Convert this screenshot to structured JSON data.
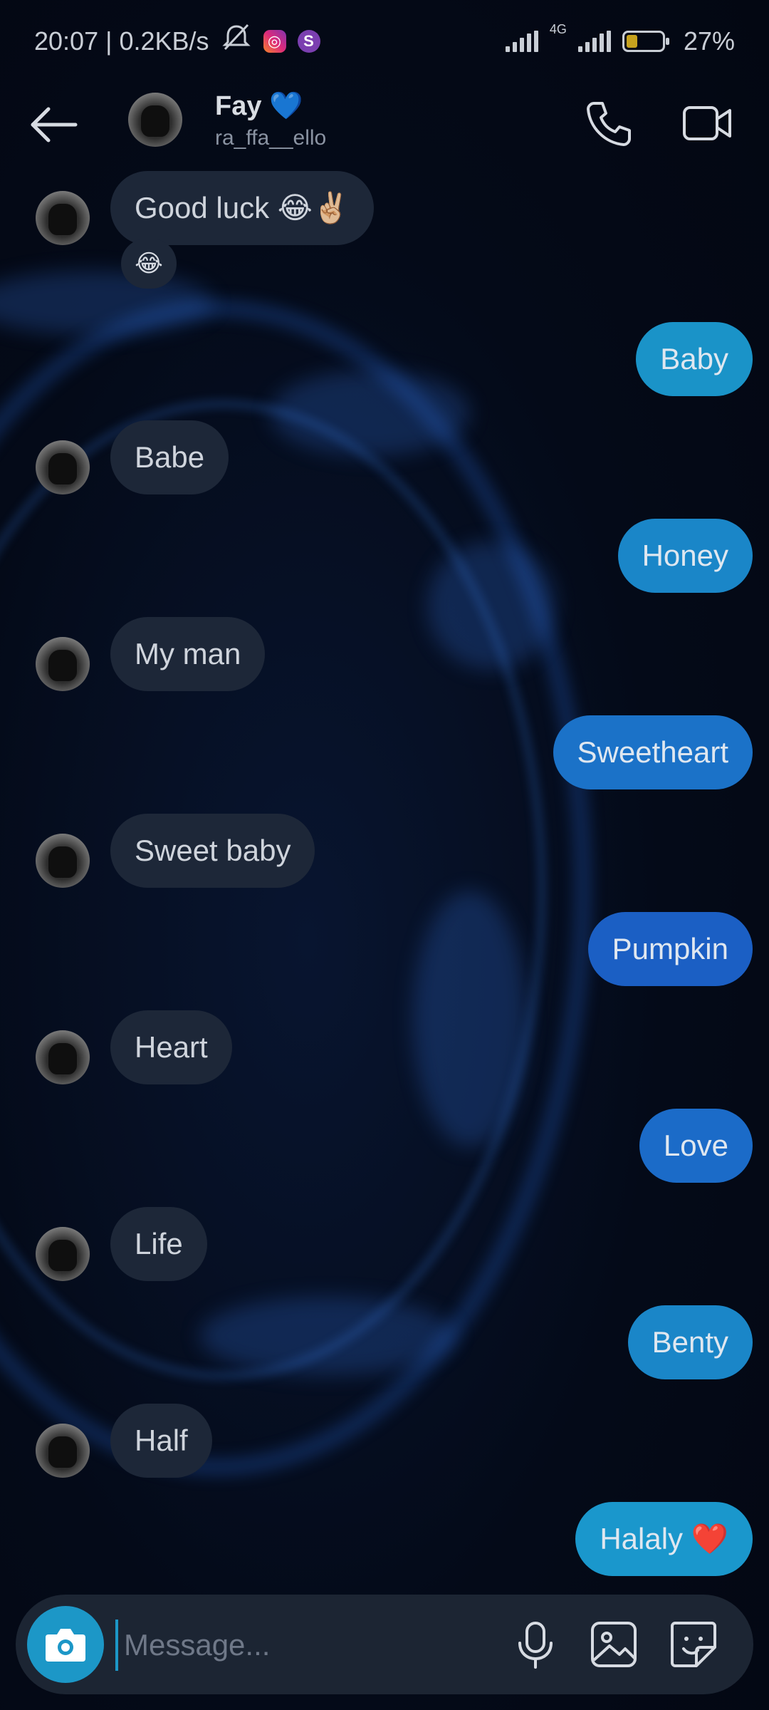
{
  "status_bar": {
    "time_speed": "20:07 | 0.2KB/s",
    "network_label": "4G",
    "battery_text": "27%",
    "battery_level": 0.27,
    "icons": [
      "mute-icon",
      "instagram-icon",
      "skype-icon",
      "signal-icon",
      "battery-icon"
    ]
  },
  "header": {
    "name": "Fay 💙",
    "handle": "ra_ffa__ello"
  },
  "messages": [
    {
      "direction": "in",
      "text": "Good luck 😂✌🏼",
      "reaction": "😂"
    },
    {
      "direction": "out",
      "text": "Baby"
    },
    {
      "direction": "in",
      "text": "Babe"
    },
    {
      "direction": "out",
      "text": "Honey"
    },
    {
      "direction": "in",
      "text": "My man"
    },
    {
      "direction": "out",
      "text": "Sweetheart"
    },
    {
      "direction": "in",
      "text": "Sweet baby"
    },
    {
      "direction": "out",
      "text": "Pumpkin"
    },
    {
      "direction": "in",
      "text": "Heart"
    },
    {
      "direction": "out",
      "text": "Love"
    },
    {
      "direction": "in",
      "text": "Life"
    },
    {
      "direction": "out",
      "text": "Benty"
    },
    {
      "direction": "in",
      "text": "Half"
    },
    {
      "direction": "out",
      "text": "Halaly ❤️"
    }
  ],
  "composer": {
    "placeholder": "Message..."
  },
  "colors": {
    "background": "#050b19",
    "incoming_bubble": "#1d2738",
    "outgoing_bubble_cyan": "#1a93c8",
    "outgoing_bubble_blue": "#1b5fc4",
    "accent": "#1c97c7"
  }
}
